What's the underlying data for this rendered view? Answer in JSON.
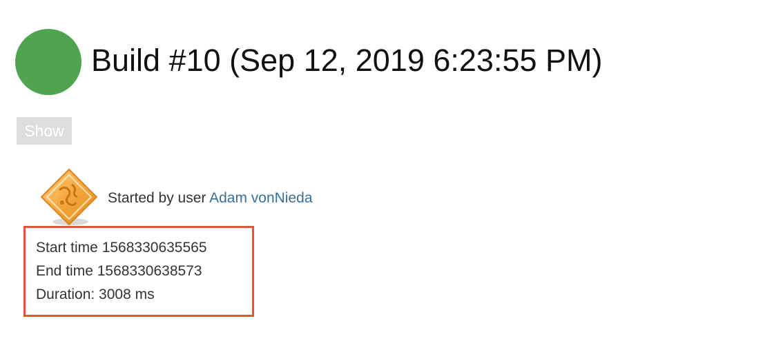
{
  "build": {
    "status_color": "#4fa450",
    "title": "Build #10 (Sep 12, 2019 6:23:55 PM)"
  },
  "show_button": {
    "label": "Show"
  },
  "cause": {
    "icon": "user-cause-icon",
    "prefix": "Started by user",
    "user_name": "Adam vonNieda"
  },
  "timing": {
    "highlight_color": "#e4533a",
    "start_time": "Start time 1568330635565",
    "end_time": "End time 1568330638573",
    "duration": "Duration: 3008 ms"
  }
}
